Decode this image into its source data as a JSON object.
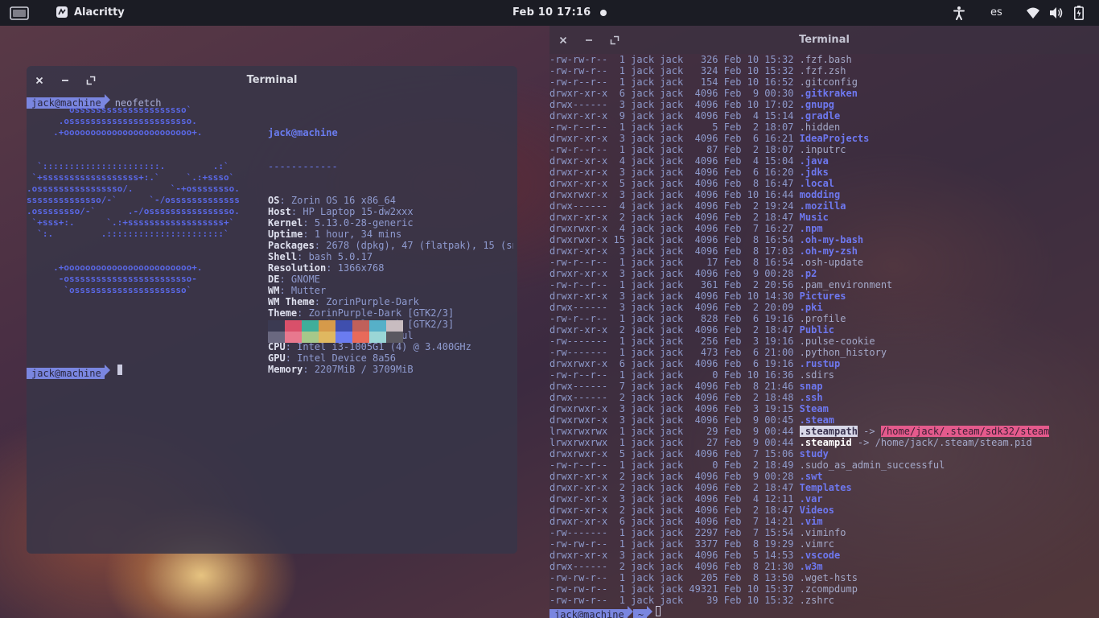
{
  "topbar": {
    "app_name": "Alacritty",
    "clock": "Feb 10  17:16",
    "language": "es",
    "icons": [
      "activities-icon",
      "app-icon",
      "accessibility-icon",
      "wifi-icon",
      "volume-icon",
      "battery-icon"
    ]
  },
  "left_terminal": {
    "title": "Terminal",
    "prompt_label": "jack@machine",
    "command": "neofetch",
    "ascii_lines": [
      "       `osssssssssssssssssssso`",
      "      .osssssssssssssssssssssso.",
      "     .+oooooooooooooooooooooooo+.",
      "",
      "",
      "  `::::::::::::::::::::::.         .:`",
      " `+ssssssssssssssssss+:.`     `.:+ssso`",
      ".ossssssssssssssso/.       `-+ossssssso.",
      "ssssssssssssso/-`      `-/osssssssssssss",
      ".ossssssso/-`      .-/ossssssssssssssso.",
      " `+sss+:.      `.:+ssssssssssssssssss+`",
      "  `:.         .::::::::::::::::::::::`",
      "",
      "",
      "     .+oooooooooooooooooooooooo+.",
      "      -osssssssssssssssssssssso-",
      "       `osssssssssssssssssssso`"
    ],
    "info": {
      "user": "jack@machine",
      "separator": "------------",
      "fields": [
        {
          "key": "OS",
          "value": "Zorin OS 16 x86_64"
        },
        {
          "key": "Host",
          "value": "HP Laptop 15-dw2xxx"
        },
        {
          "key": "Kernel",
          "value": "5.13.0-28-generic"
        },
        {
          "key": "Uptime",
          "value": "1 hour, 34 mins"
        },
        {
          "key": "Packages",
          "value": "2678 (dpkg), 47 (flatpak), 15 (sn"
        },
        {
          "key": "Shell",
          "value": "bash 5.0.17"
        },
        {
          "key": "Resolution",
          "value": "1366x768"
        },
        {
          "key": "DE",
          "value": "GNOME"
        },
        {
          "key": "WM",
          "value": "Mutter"
        },
        {
          "key": "WM Theme",
          "value": "ZorinPurple-Dark"
        },
        {
          "key": "Theme",
          "value": "ZorinPurple-Dark [GTK2/3]"
        },
        {
          "key": "Icons",
          "value": "ZorinPurple-Dark [GTK2/3]"
        },
        {
          "key": "Terminal",
          "value": "x-terminal-emul"
        },
        {
          "key": "CPU",
          "value": "Intel i3-1005G1 (4) @ 3.400GHz"
        },
        {
          "key": "GPU",
          "value": "Intel Device 8a56"
        },
        {
          "key": "Memory",
          "value": "2207MiB / 3709MiB"
        }
      ]
    },
    "palette_top": [
      "#3b3a52",
      "#d9506a",
      "#3fae9a",
      "#d69a4a",
      "#3f4fae",
      "#c0605a",
      "#56b0c8",
      "#c8bcc0"
    ],
    "palette_bottom": [
      "#6a6880",
      "#e8788e",
      "#a6c88a",
      "#e0b860",
      "#6a7cf0",
      "#e86a5a",
      "#9ad6d6",
      "#5a5860"
    ],
    "second_prompt_label": "jack@machine"
  },
  "right_terminal": {
    "title": "Terminal",
    "listing": [
      {
        "perm": "-rw-rw-r--",
        "links": "1",
        "user": "jack",
        "group": "jack",
        "size": "326",
        "month": "Feb",
        "day": "10",
        "time": "15:32",
        "name": ".fzf.bash",
        "type": "file"
      },
      {
        "perm": "-rw-rw-r--",
        "links": "1",
        "user": "jack",
        "group": "jack",
        "size": "324",
        "month": "Feb",
        "day": "10",
        "time": "15:32",
        "name": ".fzf.zsh",
        "type": "file"
      },
      {
        "perm": "-rw-r--r--",
        "links": "1",
        "user": "jack",
        "group": "jack",
        "size": "154",
        "month": "Feb",
        "day": "10",
        "time": "16:52",
        "name": ".gitconfig",
        "type": "file"
      },
      {
        "perm": "drwxr-xr-x",
        "links": "6",
        "user": "jack",
        "group": "jack",
        "size": "4096",
        "month": "Feb",
        "day": "9",
        "time": "00:30",
        "name": ".gitkraken",
        "type": "dir"
      },
      {
        "perm": "drwx------",
        "links": "3",
        "user": "jack",
        "group": "jack",
        "size": "4096",
        "month": "Feb",
        "day": "10",
        "time": "17:02",
        "name": ".gnupg",
        "type": "dir"
      },
      {
        "perm": "drwxr-xr-x",
        "links": "9",
        "user": "jack",
        "group": "jack",
        "size": "4096",
        "month": "Feb",
        "day": "4",
        "time": "15:14",
        "name": ".gradle",
        "type": "dir"
      },
      {
        "perm": "-rw-r--r--",
        "links": "1",
        "user": "jack",
        "group": "jack",
        "size": "5",
        "month": "Feb",
        "day": "2",
        "time": "18:07",
        "name": ".hidden",
        "type": "file"
      },
      {
        "perm": "drwxr-xr-x",
        "links": "3",
        "user": "jack",
        "group": "jack",
        "size": "4096",
        "month": "Feb",
        "day": "6",
        "time": "16:21",
        "name": "IdeaProjects",
        "type": "dir"
      },
      {
        "perm": "-rw-r--r--",
        "links": "1",
        "user": "jack",
        "group": "jack",
        "size": "87",
        "month": "Feb",
        "day": "2",
        "time": "18:07",
        "name": ".inputrc",
        "type": "file"
      },
      {
        "perm": "drwxr-xr-x",
        "links": "4",
        "user": "jack",
        "group": "jack",
        "size": "4096",
        "month": "Feb",
        "day": "4",
        "time": "15:04",
        "name": ".java",
        "type": "dir"
      },
      {
        "perm": "drwxr-xr-x",
        "links": "3",
        "user": "jack",
        "group": "jack",
        "size": "4096",
        "month": "Feb",
        "day": "6",
        "time": "16:20",
        "name": ".jdks",
        "type": "dir"
      },
      {
        "perm": "drwxr-xr-x",
        "links": "5",
        "user": "jack",
        "group": "jack",
        "size": "4096",
        "month": "Feb",
        "day": "8",
        "time": "16:47",
        "name": ".local",
        "type": "dir"
      },
      {
        "perm": "drwxrwxr-x",
        "links": "3",
        "user": "jack",
        "group": "jack",
        "size": "4096",
        "month": "Feb",
        "day": "10",
        "time": "16:44",
        "name": "modding",
        "type": "dir"
      },
      {
        "perm": "drwx------",
        "links": "4",
        "user": "jack",
        "group": "jack",
        "size": "4096",
        "month": "Feb",
        "day": "2",
        "time": "19:24",
        "name": ".mozilla",
        "type": "dir"
      },
      {
        "perm": "drwxr-xr-x",
        "links": "2",
        "user": "jack",
        "group": "jack",
        "size": "4096",
        "month": "Feb",
        "day": "2",
        "time": "18:47",
        "name": "Music",
        "type": "dir"
      },
      {
        "perm": "drwxrwxr-x",
        "links": "4",
        "user": "jack",
        "group": "jack",
        "size": "4096",
        "month": "Feb",
        "day": "7",
        "time": "16:27",
        "name": ".npm",
        "type": "dir"
      },
      {
        "perm": "drwxrwxr-x",
        "links": "15",
        "user": "jack",
        "group": "jack",
        "size": "4096",
        "month": "Feb",
        "day": "8",
        "time": "16:54",
        "name": ".oh-my-bash",
        "type": "dir"
      },
      {
        "perm": "drwxr-xr-x",
        "links": "3",
        "user": "jack",
        "group": "jack",
        "size": "4096",
        "month": "Feb",
        "day": "8",
        "time": "17:03",
        "name": ".oh-my-zsh",
        "type": "dir"
      },
      {
        "perm": "-rw-r--r--",
        "links": "1",
        "user": "jack",
        "group": "jack",
        "size": "17",
        "month": "Feb",
        "day": "8",
        "time": "16:54",
        "name": ".osh-update",
        "type": "file"
      },
      {
        "perm": "drwxr-xr-x",
        "links": "3",
        "user": "jack",
        "group": "jack",
        "size": "4096",
        "month": "Feb",
        "day": "9",
        "time": "00:28",
        "name": ".p2",
        "type": "dir"
      },
      {
        "perm": "-rw-r--r--",
        "links": "1",
        "user": "jack",
        "group": "jack",
        "size": "361",
        "month": "Feb",
        "day": "2",
        "time": "20:56",
        "name": ".pam_environment",
        "type": "file"
      },
      {
        "perm": "drwxr-xr-x",
        "links": "3",
        "user": "jack",
        "group": "jack",
        "size": "4096",
        "month": "Feb",
        "day": "10",
        "time": "14:30",
        "name": "Pictures",
        "type": "dir"
      },
      {
        "perm": "drwx------",
        "links": "3",
        "user": "jack",
        "group": "jack",
        "size": "4096",
        "month": "Feb",
        "day": "2",
        "time": "20:09",
        "name": ".pki",
        "type": "dir"
      },
      {
        "perm": "-rw-r--r--",
        "links": "1",
        "user": "jack",
        "group": "jack",
        "size": "828",
        "month": "Feb",
        "day": "6",
        "time": "19:16",
        "name": ".profile",
        "type": "file"
      },
      {
        "perm": "drwxr-xr-x",
        "links": "2",
        "user": "jack",
        "group": "jack",
        "size": "4096",
        "month": "Feb",
        "day": "2",
        "time": "18:47",
        "name": "Public",
        "type": "dir"
      },
      {
        "perm": "-rw-------",
        "links": "1",
        "user": "jack",
        "group": "jack",
        "size": "256",
        "month": "Feb",
        "day": "3",
        "time": "19:16",
        "name": ".pulse-cookie",
        "type": "file"
      },
      {
        "perm": "-rw-------",
        "links": "1",
        "user": "jack",
        "group": "jack",
        "size": "473",
        "month": "Feb",
        "day": "6",
        "time": "21:00",
        "name": ".python_history",
        "type": "file"
      },
      {
        "perm": "drwxrwxr-x",
        "links": "6",
        "user": "jack",
        "group": "jack",
        "size": "4096",
        "month": "Feb",
        "day": "6",
        "time": "19:16",
        "name": ".rustup",
        "type": "dir"
      },
      {
        "perm": "-rw-r--r--",
        "links": "1",
        "user": "jack",
        "group": "jack",
        "size": "0",
        "month": "Feb",
        "day": "10",
        "time": "16:36",
        "name": ".sdirs",
        "type": "file"
      },
      {
        "perm": "drwx------",
        "links": "7",
        "user": "jack",
        "group": "jack",
        "size": "4096",
        "month": "Feb",
        "day": "8",
        "time": "21:46",
        "name": "snap",
        "type": "dir"
      },
      {
        "perm": "drwx------",
        "links": "2",
        "user": "jack",
        "group": "jack",
        "size": "4096",
        "month": "Feb",
        "day": "2",
        "time": "18:48",
        "name": ".ssh",
        "type": "dir"
      },
      {
        "perm": "drwxrwxr-x",
        "links": "3",
        "user": "jack",
        "group": "jack",
        "size": "4096",
        "month": "Feb",
        "day": "3",
        "time": "19:15",
        "name": "Steam",
        "type": "dir"
      },
      {
        "perm": "drwxrwxr-x",
        "links": "3",
        "user": "jack",
        "group": "jack",
        "size": "4096",
        "month": "Feb",
        "day": "9",
        "time": "00:45",
        "name": ".steam",
        "type": "dir"
      },
      {
        "perm": "lrwxrwxrwx",
        "links": "1",
        "user": "jack",
        "group": "jack",
        "size": "29",
        "month": "Feb",
        "day": "9",
        "time": "00:44",
        "name": ".steampath",
        "type": "link-hl",
        "arrow": "->",
        "target": "/home/jack/.steam/sdk32/steam"
      },
      {
        "perm": "lrwxrwxrwx",
        "links": "1",
        "user": "jack",
        "group": "jack",
        "size": "27",
        "month": "Feb",
        "day": "9",
        "time": "00:44",
        "name": ".steampid",
        "type": "link",
        "arrow": "->",
        "target": "/home/jack/.steam/steam.pid"
      },
      {
        "perm": "drwxrwxr-x",
        "links": "5",
        "user": "jack",
        "group": "jack",
        "size": "4096",
        "month": "Feb",
        "day": "7",
        "time": "15:06",
        "name": "study",
        "type": "dir"
      },
      {
        "perm": "-rw-r--r--",
        "links": "1",
        "user": "jack",
        "group": "jack",
        "size": "0",
        "month": "Feb",
        "day": "2",
        "time": "18:49",
        "name": ".sudo_as_admin_successful",
        "type": "file"
      },
      {
        "perm": "drwxr-xr-x",
        "links": "2",
        "user": "jack",
        "group": "jack",
        "size": "4096",
        "month": "Feb",
        "day": "9",
        "time": "00:28",
        "name": ".swt",
        "type": "dir"
      },
      {
        "perm": "drwxr-xr-x",
        "links": "2",
        "user": "jack",
        "group": "jack",
        "size": "4096",
        "month": "Feb",
        "day": "2",
        "time": "18:47",
        "name": "Templates",
        "type": "dir"
      },
      {
        "perm": "drwxr-xr-x",
        "links": "3",
        "user": "jack",
        "group": "jack",
        "size": "4096",
        "month": "Feb",
        "day": "4",
        "time": "12:11",
        "name": ".var",
        "type": "dir"
      },
      {
        "perm": "drwxr-xr-x",
        "links": "2",
        "user": "jack",
        "group": "jack",
        "size": "4096",
        "month": "Feb",
        "day": "2",
        "time": "18:47",
        "name": "Videos",
        "type": "dir"
      },
      {
        "perm": "drwxr-xr-x",
        "links": "6",
        "user": "jack",
        "group": "jack",
        "size": "4096",
        "month": "Feb",
        "day": "7",
        "time": "14:21",
        "name": ".vim",
        "type": "dir"
      },
      {
        "perm": "-rw-------",
        "links": "1",
        "user": "jack",
        "group": "jack",
        "size": "2297",
        "month": "Feb",
        "day": "7",
        "time": "15:54",
        "name": ".viminfo",
        "type": "file"
      },
      {
        "perm": "-rw-rw-r--",
        "links": "1",
        "user": "jack",
        "group": "jack",
        "size": "3377",
        "month": "Feb",
        "day": "8",
        "time": "19:29",
        "name": ".vimrc",
        "type": "file"
      },
      {
        "perm": "drwxr-xr-x",
        "links": "3",
        "user": "jack",
        "group": "jack",
        "size": "4096",
        "month": "Feb",
        "day": "5",
        "time": "14:53",
        "name": ".vscode",
        "type": "dir"
      },
      {
        "perm": "drwx------",
        "links": "2",
        "user": "jack",
        "group": "jack",
        "size": "4096",
        "month": "Feb",
        "day": "8",
        "time": "21:30",
        "name": ".w3m",
        "type": "dir"
      },
      {
        "perm": "-rw-rw-r--",
        "links": "1",
        "user": "jack",
        "group": "jack",
        "size": "205",
        "month": "Feb",
        "day": "8",
        "time": "13:50",
        "name": ".wget-hsts",
        "type": "file"
      },
      {
        "perm": "-rw-rw-r--",
        "links": "1",
        "user": "jack",
        "group": "jack",
        "size": "49321",
        "month": "Feb",
        "day": "10",
        "time": "15:37",
        "name": ".zcompdump",
        "type": "file"
      },
      {
        "perm": "-rw-rw-r--",
        "links": "1",
        "user": "jack",
        "group": "jack",
        "size": "39",
        "month": "Feb",
        "day": "10",
        "time": "15:32",
        "name": ".zshrc",
        "type": "file"
      }
    ],
    "prompt_label": "jack@machine",
    "prompt_dir": "~"
  }
}
